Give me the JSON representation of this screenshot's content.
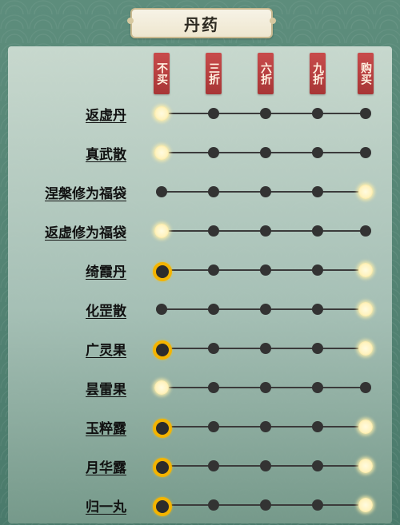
{
  "title": "丹药",
  "columns": [
    "不买",
    "三折",
    "六折",
    "九折",
    "购买"
  ],
  "rows": [
    {
      "name": "返虚丹",
      "selected": 0
    },
    {
      "name": "真武散",
      "selected": 0
    },
    {
      "name": "涅槃修为福袋",
      "selected": 4
    },
    {
      "name": "返虚修为福袋",
      "selected": 0
    },
    {
      "name": "绮霞丹",
      "selected": 0,
      "also_selected": 4
    },
    {
      "name": "化罡散",
      "selected": 4
    },
    {
      "name": "广灵果",
      "selected": 0,
      "also_selected": 4
    },
    {
      "name": "昙雷果",
      "selected": 0
    },
    {
      "name": "玉粹露",
      "selected": 0,
      "also_selected": 4
    },
    {
      "name": "月华露",
      "selected": 0,
      "also_selected": 4
    },
    {
      "name": "归一丸",
      "selected": 0,
      "also_selected": 4
    }
  ]
}
